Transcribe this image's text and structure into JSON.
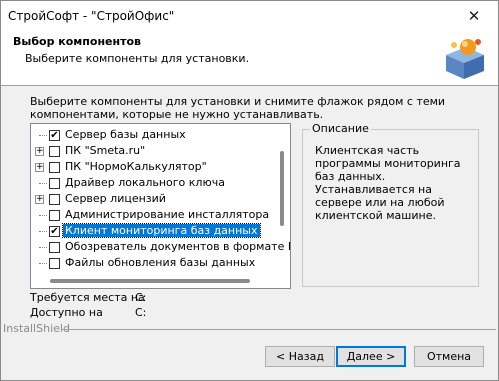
{
  "window": {
    "title": "СтройСофт - \"СтройОфис\"",
    "close_glyph": "✕"
  },
  "header": {
    "title": "Выбор компонентов",
    "subtitle": "Выберите компоненты для установки.",
    "logo_icon": "installer-box-icon"
  },
  "instructions": "Выберите компоненты для установки и снимите флажок рядом с теми компонентами, которые не нужно устанавливать.",
  "components": [
    {
      "label": "Сервер базы данных",
      "checked": true,
      "expandable": false,
      "selected": false
    },
    {
      "label": "ПК \"Smeta.ru\"",
      "checked": false,
      "expandable": true,
      "selected": false
    },
    {
      "label": "ПК \"НормоКалькулятор\"",
      "checked": false,
      "expandable": true,
      "selected": false
    },
    {
      "label": "Драйвер локального ключа",
      "checked": false,
      "expandable": false,
      "selected": false
    },
    {
      "label": "Сервер лицензий",
      "checked": false,
      "expandable": true,
      "selected": false
    },
    {
      "label": "Администрирование инсталлятора",
      "checked": false,
      "expandable": false,
      "selected": false
    },
    {
      "label": "Клиент мониторинга баз данных",
      "checked": true,
      "expandable": false,
      "selected": true
    },
    {
      "label": "Обозреватель документов в формате DOC",
      "checked": false,
      "expandable": false,
      "selected": false
    },
    {
      "label": "Файлы обновления базы данных",
      "checked": false,
      "expandable": false,
      "selected": false
    }
  ],
  "description": {
    "legend": "Описание",
    "text": "Клиентская часть программы мониторинга баз данных. Устанавливается на сервере или на любой клиентской машине."
  },
  "space": {
    "required_label": "Требуется места на",
    "required_value": "C:",
    "available_label": "Доступно на",
    "available_value": "C:"
  },
  "brand": "InstallShield",
  "buttons": {
    "back": "< Назад",
    "next": "Далее >",
    "cancel": "Отмена"
  },
  "colors": {
    "selection": "#0078d7",
    "default_button_border": "#0078d7"
  }
}
